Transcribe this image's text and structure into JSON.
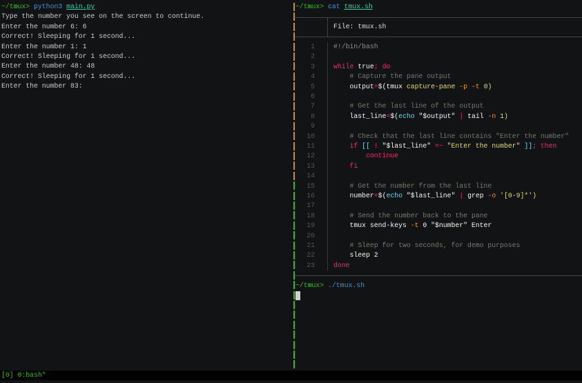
{
  "left_pane": {
    "prompt": "~/tmux>",
    "command": "python3",
    "argument": "main.py",
    "output": [
      "Type the number you see on the screen to continue.",
      "Enter the number 6: 6",
      "Correct! Sleeping for 1 second...",
      "Enter the number 1: 1",
      "Correct! Sleeping for 1 second...",
      "Enter the number 48: 48",
      "Correct! Sleeping for 1 second...",
      "Enter the number 83:"
    ]
  },
  "right_pane": {
    "prompt": "~/tmux>",
    "command": "cat",
    "argument": "tmux.sh",
    "file_header": "File: tmux.sh",
    "code_lines": [
      [
        [
          "#!/bin/bash",
          "sh"
        ]
      ],
      [],
      [
        [
          "while",
          "k"
        ],
        [
          " true",
          "w"
        ],
        [
          ";",
          "k"
        ],
        [
          " do",
          "k"
        ]
      ],
      [
        [
          "    # Capture the pane output",
          "c"
        ]
      ],
      [
        [
          "    output",
          "w"
        ],
        [
          "=",
          "p"
        ],
        [
          "$(tmux ",
          "w"
        ],
        [
          "capture-pane",
          "s"
        ],
        [
          " -p -t",
          "o"
        ],
        [
          " 0)",
          "s"
        ]
      ],
      [],
      [
        [
          "    # Get the last line of the output",
          "c"
        ]
      ],
      [
        [
          "    last_line",
          "w"
        ],
        [
          "=",
          "p"
        ],
        [
          "$(",
          "w"
        ],
        [
          "echo",
          "y"
        ],
        [
          " \"$output\" ",
          "w"
        ],
        [
          "|",
          "k"
        ],
        [
          " tail",
          "w"
        ],
        [
          " -n",
          "o"
        ],
        [
          " 1)",
          "s"
        ]
      ],
      [],
      [
        [
          "    # Check that the last line contains \"Enter the number\"",
          "c"
        ]
      ],
      [
        [
          "    if",
          "k"
        ],
        [
          " [[",
          "y"
        ],
        [
          " !",
          "k"
        ],
        [
          " \"$last_line\"",
          "w"
        ],
        [
          " =~",
          "p"
        ],
        [
          " \"Enter the number\"",
          "s"
        ],
        [
          " ]]",
          "y"
        ],
        [
          ";",
          "k"
        ],
        [
          " then",
          "k"
        ]
      ],
      [
        [
          "        continue",
          "k"
        ]
      ],
      [
        [
          "    fi",
          "k"
        ]
      ],
      [],
      [
        [
          "    # Get the number from the last line",
          "c"
        ]
      ],
      [
        [
          "    number",
          "w"
        ],
        [
          "=",
          "p"
        ],
        [
          "$(",
          "w"
        ],
        [
          "echo",
          "y"
        ],
        [
          " \"$last_line\" ",
          "w"
        ],
        [
          "|",
          "k"
        ],
        [
          " grep",
          "w"
        ],
        [
          " -o",
          "o"
        ],
        [
          " '[0-9]*')",
          "s"
        ]
      ],
      [],
      [
        [
          "    # Send the number back to the pane",
          "c"
        ]
      ],
      [
        [
          "    tmux send-keys",
          "w"
        ],
        [
          " -t",
          "o"
        ],
        [
          " 0 \"$number\" Enter",
          "w"
        ]
      ],
      [],
      [
        [
          "    # Sleep for two seconds, for demo purposes",
          "c"
        ]
      ],
      [
        [
          "    sleep 2",
          "w"
        ]
      ],
      [
        [
          "done",
          "k"
        ]
      ]
    ],
    "prompt2": "~/tmux>",
    "command2": "./tmux.sh"
  },
  "status_bar": {
    "text": "[0] 0:bash*"
  },
  "colors": {
    "active_border": "#3fb618",
    "inactive_border": "#c8902a",
    "background": "#121314"
  }
}
